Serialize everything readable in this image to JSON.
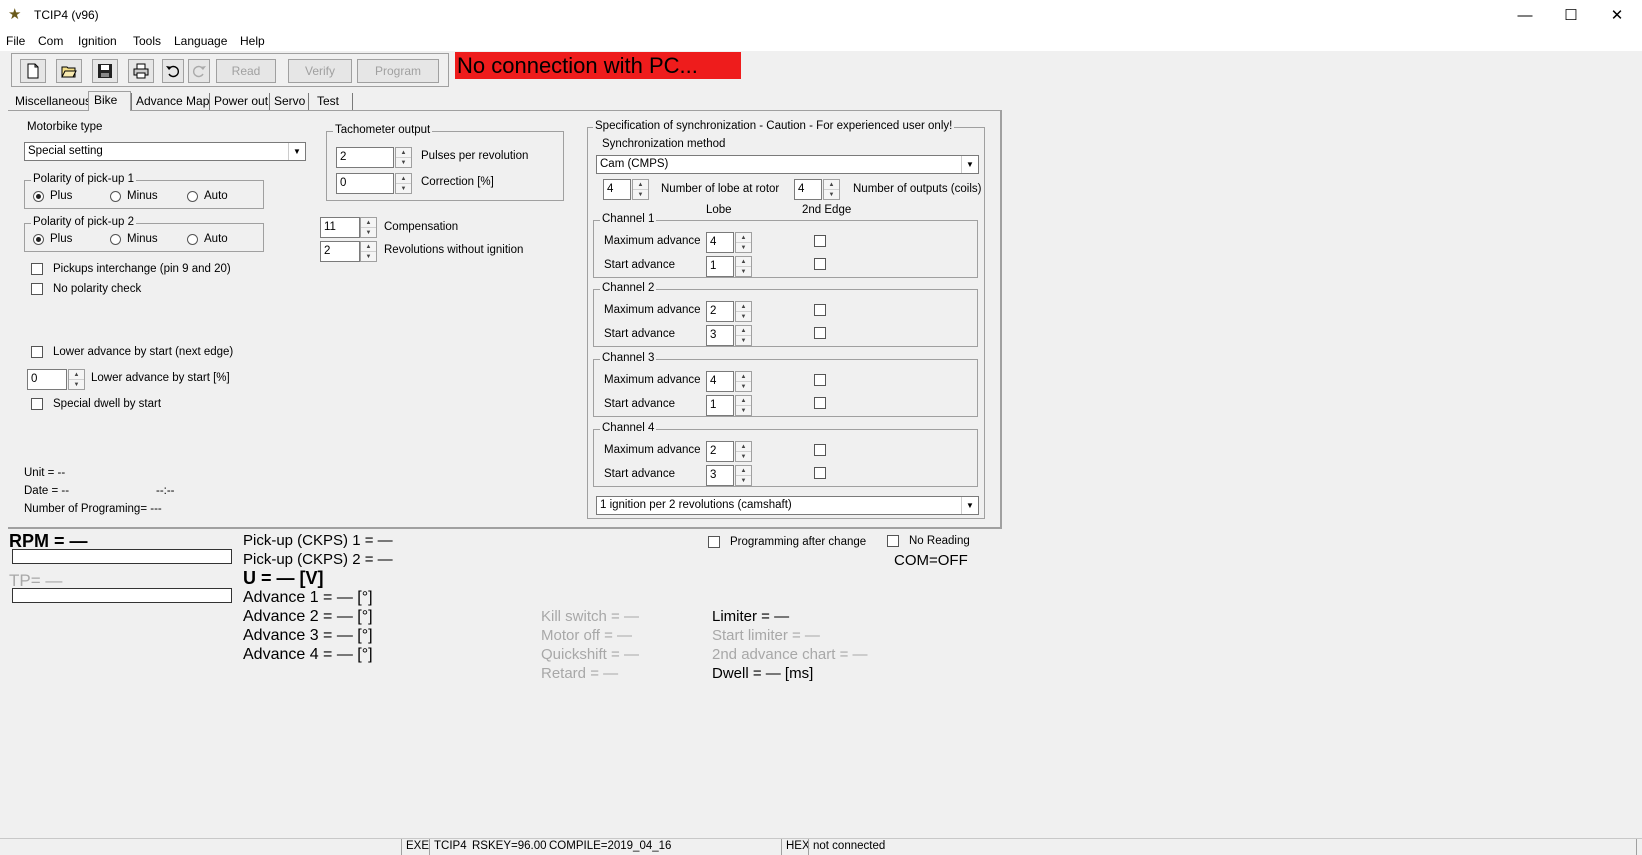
{
  "window": {
    "title": "TCIP4 (v96)"
  },
  "menu": [
    "File",
    "Com",
    "Ignition",
    "Tools",
    "Language",
    "Help"
  ],
  "toolbar": {
    "read_label": "Read",
    "verify_label": "Verify",
    "program_label": "Program"
  },
  "banner": "No connection with PC...",
  "tabs": [
    "Miscellaneous",
    "Bike",
    "Advance Map",
    "Power out",
    "Servo",
    "Test"
  ],
  "bike": {
    "motorbike_type_label": "Motorbike type",
    "motorbike_type_value": "Special setting",
    "polarity1_label": "Polarity of pick-up 1",
    "polarity2_label": "Polarity of pick-up 2",
    "polarity_options": [
      "Plus",
      "Minus",
      "Auto"
    ],
    "pickups_interchange": "Pickups interchange (pin 9 and 20)",
    "no_polarity_check": "No polarity check",
    "lower_advance_next_edge": "Lower advance by start (next edge)",
    "lower_advance_percent_value": "0",
    "lower_advance_percent_label": "Lower advance by start [%]",
    "special_dwell": "Special dwell by start",
    "unit": "Unit = --",
    "date": "Date = --",
    "time": "--:--",
    "num_programming": "Number of Programing= ---"
  },
  "tacho": {
    "title": "Tachometer output",
    "pulses_value": "2",
    "pulses_label": "Pulses per revolution",
    "correction_value": "0",
    "correction_label": "Correction [%]"
  },
  "compensation": {
    "value": "11",
    "label": "Compensation"
  },
  "revs_without_ignition": {
    "value": "2",
    "label": "Revolutions without ignition"
  },
  "sync": {
    "title": "Specification of synchronization - Caution - For experienced user only!",
    "method_label": "Synchronization method",
    "method_value": "Cam (CMPS)",
    "lobes_value": "4",
    "lobes_label": "Number of lobe at rotor",
    "outputs_value": "4",
    "outputs_label": "Number of outputs (coils)",
    "col_lobe": "Lobe",
    "col_edge": "2nd Edge",
    "max_advance_label": "Maximum advance",
    "start_advance_label": "Start advance",
    "channels": [
      {
        "title": "Channel 1",
        "max": "4",
        "start": "1"
      },
      {
        "title": "Channel 2",
        "max": "2",
        "start": "3"
      },
      {
        "title": "Channel 3",
        "max": "4",
        "start": "1"
      },
      {
        "title": "Channel 4",
        "max": "2",
        "start": "3"
      }
    ],
    "ignition_mode": "1 ignition per 2 revolutions (camshaft)"
  },
  "live": {
    "rpm": "RPM = —",
    "tp": "TP= —",
    "pickup1": "Pick-up (CKPS) 1 =  —",
    "pickup2": "Pick-up (CKPS) 2 =  —",
    "voltage": "U = — [V]",
    "adv1": "Advance 1 = — [°]",
    "adv2": "Advance 2 = — [°]",
    "adv3": "Advance 3 = — [°]",
    "adv4": "Advance 4 = — [°]",
    "kill_switch": "Kill switch = —",
    "motor_off": "Motor off = —",
    "quickshift": "Quickshift = —",
    "retard": "Retard = —",
    "limiter": "Limiter = —",
    "start_limiter": "Start limiter = —",
    "second_chart": "2nd advance chart = —",
    "dwell": "Dwell = — [ms]",
    "programming_after_change": "Programming after change",
    "no_reading": "No Reading",
    "com_status": "COM=OFF"
  },
  "status": {
    "exe": "EXE",
    "name": "TCIP4",
    "rskey": "RSKEY=96.00",
    "compile": "COMPILE=2019_04_16",
    "hex": "HEX",
    "conn": "not connected"
  }
}
